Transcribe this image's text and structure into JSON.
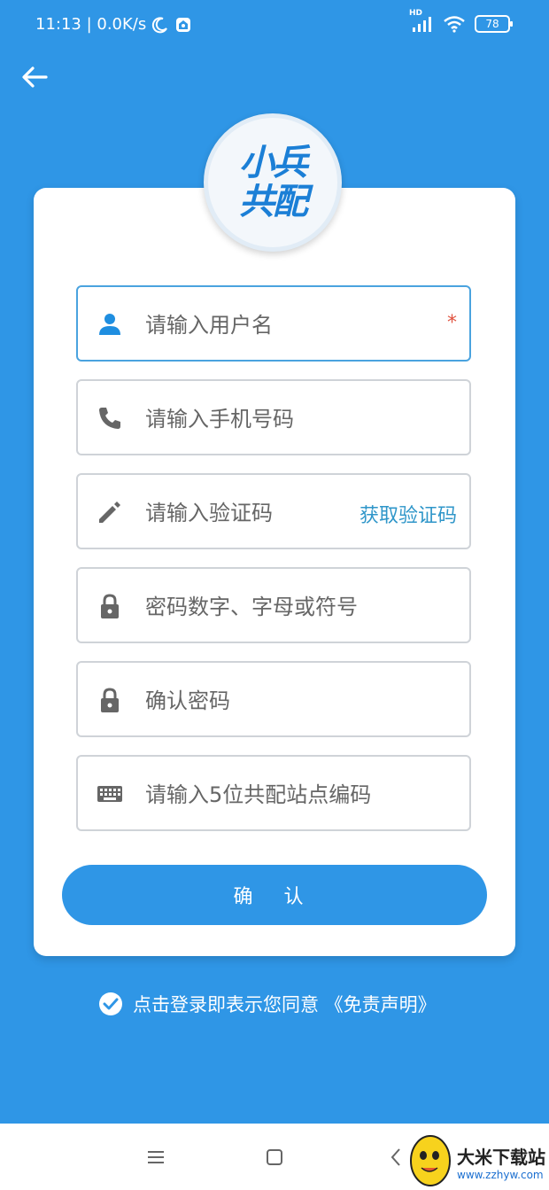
{
  "status_bar": {
    "time_speed": "11:13 | 0.0K/s",
    "network_label": "HD",
    "battery": "78"
  },
  "logo": {
    "line1": "小兵",
    "line2": "共配"
  },
  "form": {
    "username": {
      "placeholder": "请输入用户名",
      "required_mark": "*"
    },
    "phone": {
      "placeholder": "请输入手机号码"
    },
    "code": {
      "placeholder": "请输入验证码",
      "action": "获取验证码"
    },
    "password": {
      "placeholder": "密码数字、字母或符号"
    },
    "confirm_password": {
      "placeholder": "确认密码"
    },
    "station_code": {
      "placeholder": "请输入5位共配站点编码"
    },
    "submit_label": "确 认"
  },
  "agreement": {
    "text": "点击登录即表示您同意 《免责声明》"
  },
  "watermark": {
    "title": "大米下载站",
    "url": "www.zzhyw.com"
  },
  "colors": {
    "primary": "#2f96e6",
    "link": "#2f96c9",
    "required": "#e0523f"
  }
}
